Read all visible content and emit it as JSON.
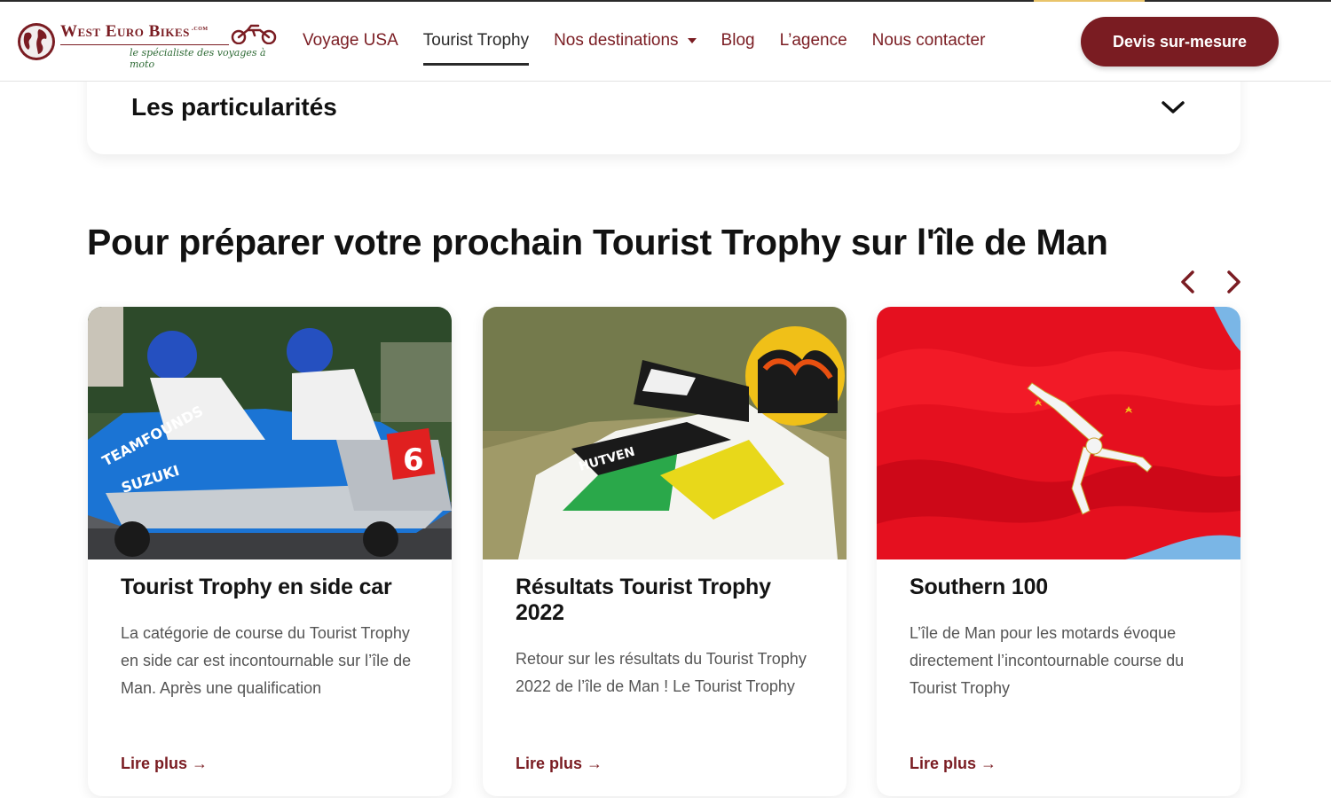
{
  "header": {
    "logo": {
      "brand": "West Euro Bikes",
      "domain_suffix": ".com",
      "tagline": "le spécialiste des voyages à moto"
    },
    "nav": [
      {
        "label": "Voyage USA"
      },
      {
        "label": "Tourist Trophy"
      },
      {
        "label": "Nos destinations"
      },
      {
        "label": "Blog"
      },
      {
        "label": "L’agence"
      },
      {
        "label": "Nous contacter"
      }
    ],
    "cta_label": "Devis sur-mesure"
  },
  "accordion": {
    "title": "Les particularités"
  },
  "section": {
    "title": "Pour préparer votre prochain Tourist Trophy sur l'île de Man"
  },
  "cards": [
    {
      "title": "Tourist Trophy en side car",
      "excerpt": "La catégorie de course du Tourist Trophy en side car est incontournable sur l’île de Man. Après une qualification",
      "link_label": "Lire plus →"
    },
    {
      "title": "Résultats Tourist Trophy 2022",
      "excerpt": "Retour sur les résultats du Tourist Trophy 2022 de l’île de Man ! Le Tourist Trophy",
      "link_label": "Lire plus →"
    },
    {
      "title": "Southern 100",
      "excerpt": "L’île de Man pour les motards évoque directement l’incontournable course du Tourist Trophy",
      "link_label": "Lire plus →"
    }
  ],
  "colors": {
    "brand": "#7a1c22",
    "tagline": "#2f6b36",
    "text": "#121212"
  }
}
